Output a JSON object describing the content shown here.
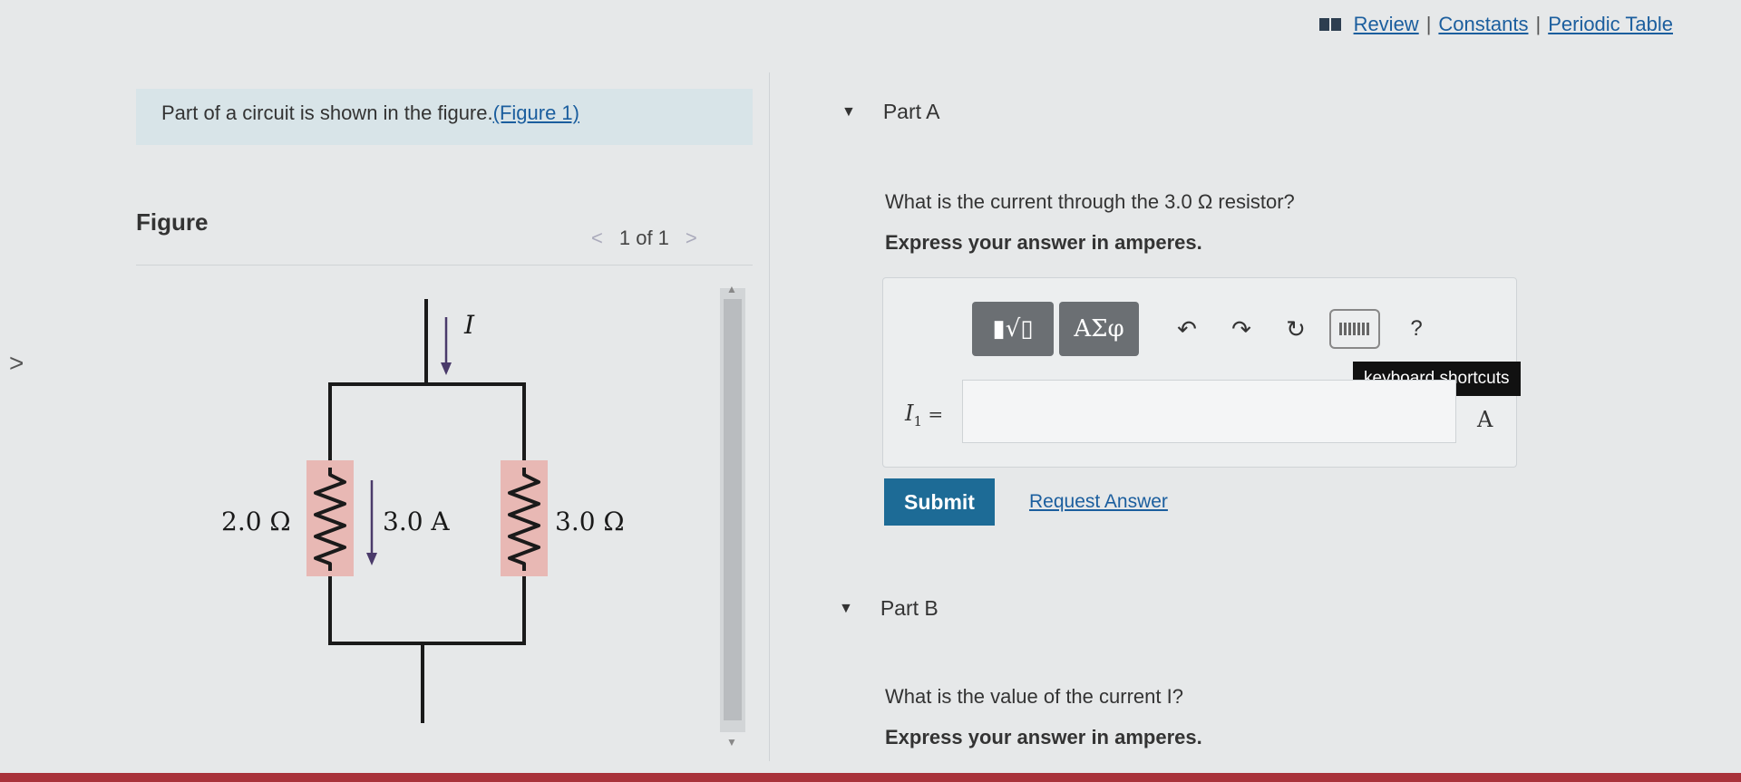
{
  "topbar": {
    "links": [
      "Review",
      "Constants",
      "Periodic Table"
    ],
    "separator": "|"
  },
  "intro": {
    "text": "Part of a circuit is shown in the figure.",
    "figure_link": "(Figure 1)"
  },
  "figure": {
    "label": "Figure",
    "pager": "1 of 1",
    "prev": "<",
    "next": ">",
    "circuit": {
      "current_label": "I",
      "left_resistor": "2.0 Ω",
      "middle_current": "3.0 A",
      "right_resistor": "3.0 Ω"
    }
  },
  "part_a": {
    "title": "Part A",
    "question": "What is the current through the 3.0 Ω resistor?",
    "instruction": "Express your answer in amperes.",
    "toolbar": {
      "templates_label": "▮√▯",
      "greek_label": "ΑΣφ",
      "undo": "↶",
      "redo": "↷",
      "reset": "↻",
      "help": "?",
      "tooltip": "keyboard shortcuts"
    },
    "variable": "I",
    "variable_sub": "1",
    "equals": " =",
    "input_value": "",
    "unit": "A",
    "submit_label": "Submit",
    "request_label": "Request Answer"
  },
  "part_b": {
    "title": "Part B",
    "question": "What is the value of the current I?",
    "instruction": "Express your answer in amperes."
  },
  "colors": {
    "link": "#1b5e9e",
    "submit": "#1d6b96",
    "intro_bg": "#d8e4e8",
    "resistor_highlight": "#e8b8b4",
    "arrow": "#4a3a6a"
  }
}
